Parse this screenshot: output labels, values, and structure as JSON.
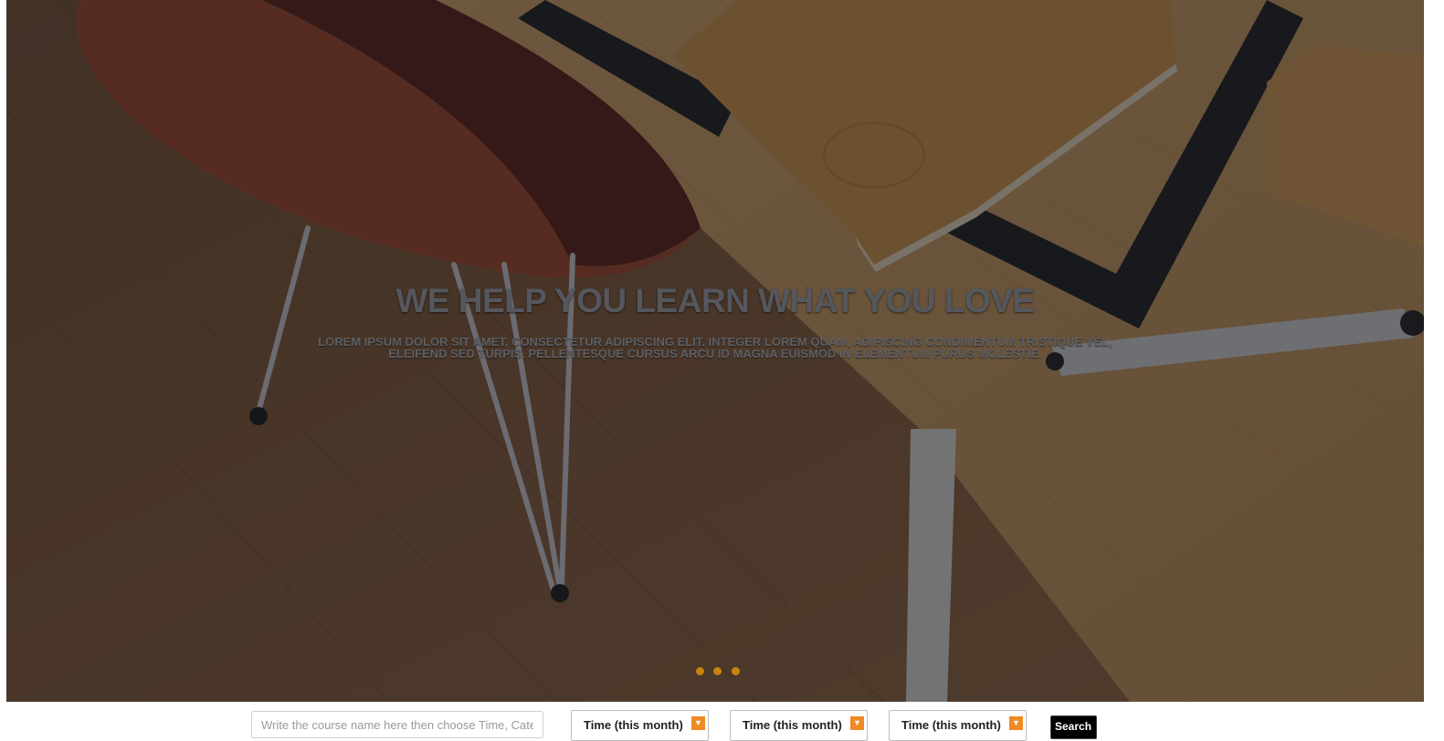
{
  "hero": {
    "title": "WE HELP YOU LEARN WHAT YOU LOVE",
    "subtitle": "LOREM IPSUM DOLOR SIT AMET, CONSECTETUR ADIPISCING ELIT. INTEGER LOREM QUAM, ADIPISCING CONDIMENTUM TRISTIQUE VEL, ELEIFEND SED TURPIS. PELLENTESQUE CURSUS ARCU ID MAGNA EUISMOD IN ELEMENTUM PURUS MOLESTIE.",
    "slide_count": 3,
    "dot_color": "#c9830f"
  },
  "search": {
    "course_placeholder": "Write the course name here then choose Time, Catego",
    "filters": [
      {
        "label": "Time (this month)"
      },
      {
        "label": "Time (this month)"
      },
      {
        "label": "Time (this month)"
      }
    ],
    "arrow_color": "#f08a24",
    "search_label": "Search"
  }
}
